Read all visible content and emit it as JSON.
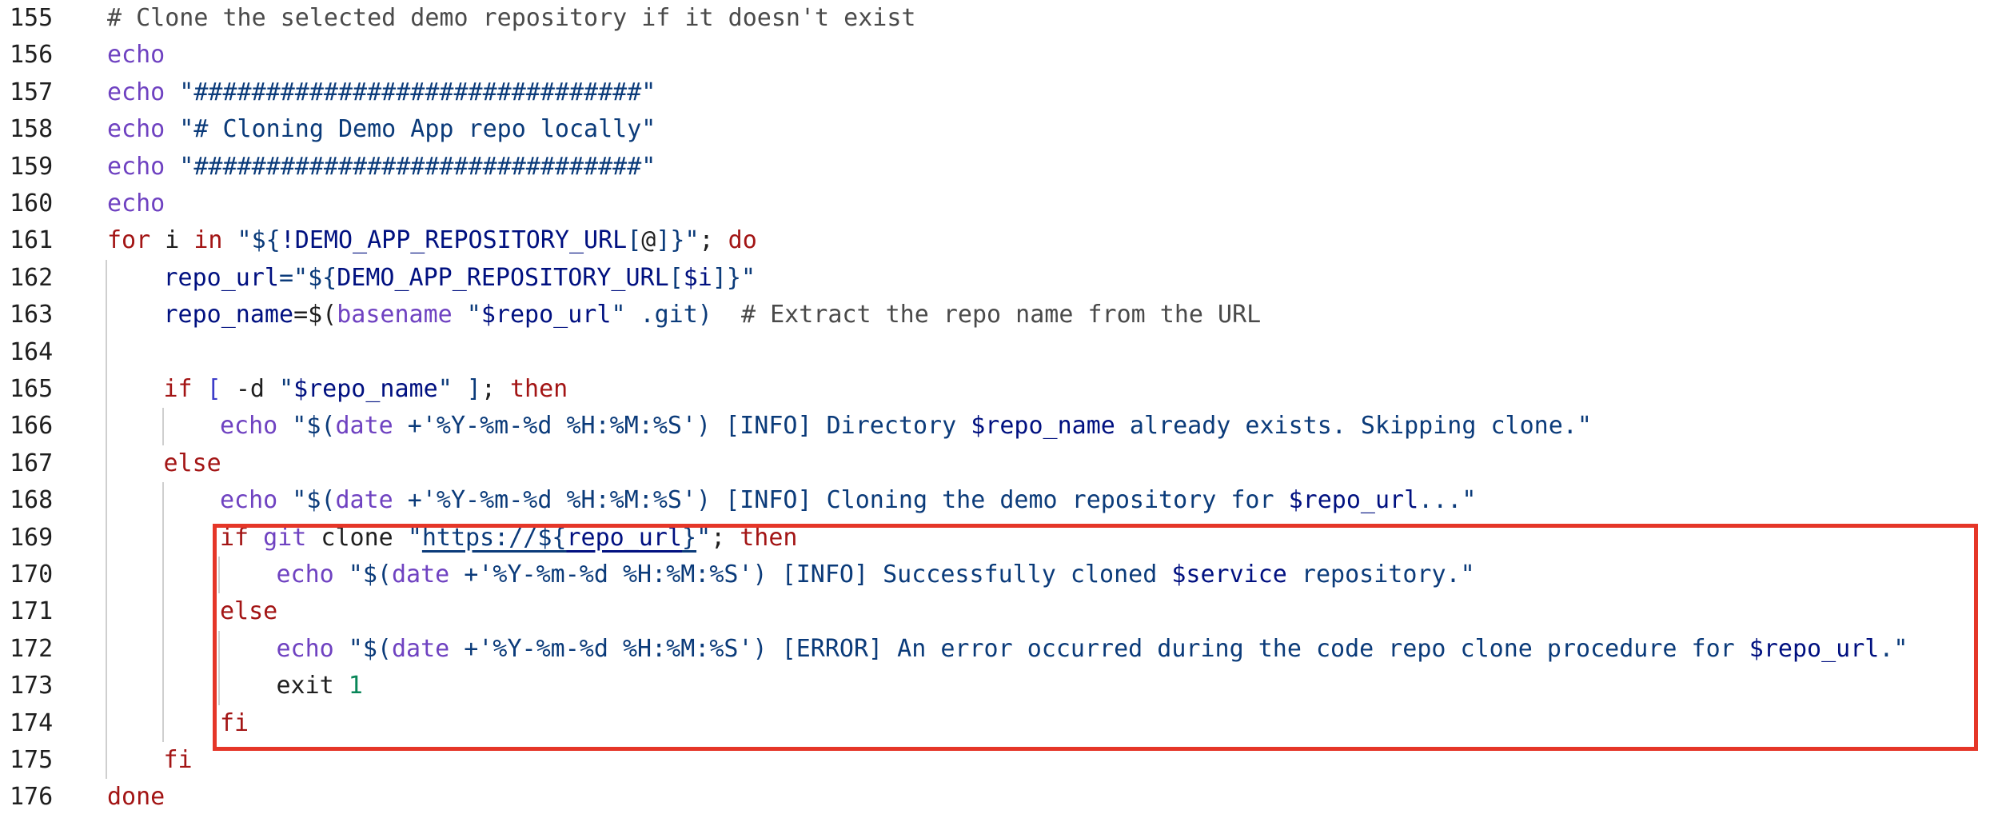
{
  "editor": {
    "highlight_color": "#e53628",
    "token_colors": {
      "keyword": "#a31515",
      "command": "#6f42c1",
      "builtin": "#3c3cc8",
      "string": "#0b3b7a",
      "variable": "#001080",
      "comment": "#4a4a4a",
      "number": "#098658",
      "plain": "#1f1f1f"
    },
    "highlighted_lines": [
      169,
      170,
      171,
      172,
      173,
      174
    ],
    "lines": [
      {
        "num": "155",
        "indent": 0,
        "tokens": [
          {
            "t": "# Clone the selected demo repository if it doesn't exist",
            "c": "cm"
          }
        ]
      },
      {
        "num": "156",
        "indent": 0,
        "tokens": [
          {
            "t": "echo",
            "c": "cmd"
          }
        ]
      },
      {
        "num": "157",
        "indent": 0,
        "tokens": [
          {
            "t": "echo",
            "c": "cmd"
          },
          {
            "t": " \"###############################\"",
            "c": "str"
          }
        ]
      },
      {
        "num": "158",
        "indent": 0,
        "tokens": [
          {
            "t": "echo",
            "c": "cmd"
          },
          {
            "t": " \"# Cloning Demo App repo locally\"",
            "c": "str"
          }
        ]
      },
      {
        "num": "159",
        "indent": 0,
        "tokens": [
          {
            "t": "echo",
            "c": "cmd"
          },
          {
            "t": " \"###############################\"",
            "c": "str"
          }
        ]
      },
      {
        "num": "160",
        "indent": 0,
        "tokens": [
          {
            "t": "echo",
            "c": "cmd"
          }
        ]
      },
      {
        "num": "161",
        "indent": 0,
        "tokens": [
          {
            "t": "for",
            "c": "kw"
          },
          {
            "t": " i ",
            "c": "pl"
          },
          {
            "t": "in",
            "c": "kw"
          },
          {
            "t": " \"${",
            "c": "str"
          },
          {
            "t": "!DEMO_APP_REPOSITORY_URL",
            "c": "var"
          },
          {
            "t": "[",
            "c": "str"
          },
          {
            "t": "@",
            "c": "pl"
          },
          {
            "t": "]}\"",
            "c": "str"
          },
          {
            "t": "; ",
            "c": "pl"
          },
          {
            "t": "do",
            "c": "kw"
          }
        ]
      },
      {
        "num": "162",
        "indent": 1,
        "tokens": [
          {
            "t": "repo_url",
            "c": "var"
          },
          {
            "t": "=\"${",
            "c": "str"
          },
          {
            "t": "DEMO_APP_REPOSITORY_URL",
            "c": "var"
          },
          {
            "t": "[",
            "c": "str"
          },
          {
            "t": "$i",
            "c": "var"
          },
          {
            "t": "]}\"",
            "c": "str"
          }
        ]
      },
      {
        "num": "163",
        "indent": 1,
        "tokens": [
          {
            "t": "repo_name",
            "c": "var"
          },
          {
            "t": "=$(",
            "c": "pl"
          },
          {
            "t": "basename",
            "c": "cmd"
          },
          {
            "t": " \"",
            "c": "str"
          },
          {
            "t": "$repo_url",
            "c": "var"
          },
          {
            "t": "\" .git)",
            "c": "str"
          },
          {
            "t": "  # Extract the repo name from the URL",
            "c": "cm"
          }
        ]
      },
      {
        "num": "164",
        "indent": 1,
        "tokens": []
      },
      {
        "num": "165",
        "indent": 1,
        "tokens": [
          {
            "t": "if",
            "c": "kw"
          },
          {
            "t": " [ ",
            "c": "bi"
          },
          {
            "t": "-d",
            "c": "pl"
          },
          {
            "t": " \"",
            "c": "str"
          },
          {
            "t": "$repo_name",
            "c": "var"
          },
          {
            "t": "\" ]",
            "c": "str"
          },
          {
            "t": "; ",
            "c": "pl"
          },
          {
            "t": "then",
            "c": "kw"
          }
        ]
      },
      {
        "num": "166",
        "indent": 2,
        "tokens": [
          {
            "t": "echo",
            "c": "cmd"
          },
          {
            "t": " \"$(",
            "c": "str"
          },
          {
            "t": "date",
            "c": "cmd"
          },
          {
            "t": " +'%Y-%m-%d %H:%M:%S') [INFO] Directory ",
            "c": "str"
          },
          {
            "t": "$repo_name",
            "c": "var"
          },
          {
            "t": " already exists. Skipping clone.\"",
            "c": "str"
          }
        ]
      },
      {
        "num": "167",
        "indent": 1,
        "tokens": [
          {
            "t": "else",
            "c": "kw"
          }
        ]
      },
      {
        "num": "168",
        "indent": 2,
        "tokens": [
          {
            "t": "echo",
            "c": "cmd"
          },
          {
            "t": " \"$(",
            "c": "str"
          },
          {
            "t": "date",
            "c": "cmd"
          },
          {
            "t": " +'%Y-%m-%d %H:%M:%S') [INFO] Cloning the demo repository for ",
            "c": "str"
          },
          {
            "t": "$repo_url",
            "c": "var"
          },
          {
            "t": "...\"",
            "c": "str"
          }
        ]
      },
      {
        "num": "169",
        "indent": 2,
        "tokens": [
          {
            "t": "if",
            "c": "kw"
          },
          {
            "t": " git",
            "c": "cmd"
          },
          {
            "t": " clone ",
            "c": "pl"
          },
          {
            "t": "\"",
            "c": "str"
          },
          {
            "t": "https://${",
            "c": "str",
            "link": true
          },
          {
            "t": "repo_url",
            "c": "var",
            "link": true
          },
          {
            "t": "}",
            "c": "str",
            "link": true
          },
          {
            "t": "\"",
            "c": "str"
          },
          {
            "t": "; ",
            "c": "pl"
          },
          {
            "t": "then",
            "c": "kw"
          }
        ]
      },
      {
        "num": "170",
        "indent": 3,
        "tokens": [
          {
            "t": "echo",
            "c": "cmd"
          },
          {
            "t": " \"$(",
            "c": "str"
          },
          {
            "t": "date",
            "c": "cmd"
          },
          {
            "t": " +'%Y-%m-%d %H:%M:%S') [INFO] Successfully cloned ",
            "c": "str"
          },
          {
            "t": "$service",
            "c": "var"
          },
          {
            "t": " repository.\"",
            "c": "str"
          }
        ]
      },
      {
        "num": "171",
        "indent": 2,
        "tokens": [
          {
            "t": "else",
            "c": "kw"
          }
        ]
      },
      {
        "num": "172",
        "indent": 3,
        "tokens": [
          {
            "t": "echo",
            "c": "cmd"
          },
          {
            "t": " \"$(",
            "c": "str"
          },
          {
            "t": "date",
            "c": "cmd"
          },
          {
            "t": " +'%Y-%m-%d %H:%M:%S') [ERROR] An error occurred during the code repo clone procedure for ",
            "c": "str"
          },
          {
            "t": "$repo_url",
            "c": "var"
          },
          {
            "t": ".\"",
            "c": "str"
          }
        ]
      },
      {
        "num": "173",
        "indent": 3,
        "tokens": [
          {
            "t": "exit",
            "c": "pl"
          },
          {
            "t": " 1",
            "c": "num"
          }
        ]
      },
      {
        "num": "174",
        "indent": 2,
        "tokens": [
          {
            "t": "fi",
            "c": "kw"
          }
        ]
      },
      {
        "num": "175",
        "indent": 1,
        "tokens": [
          {
            "t": "fi",
            "c": "kw"
          }
        ]
      },
      {
        "num": "176",
        "indent": 0,
        "tokens": [
          {
            "t": "done",
            "c": "kw"
          }
        ]
      }
    ]
  }
}
